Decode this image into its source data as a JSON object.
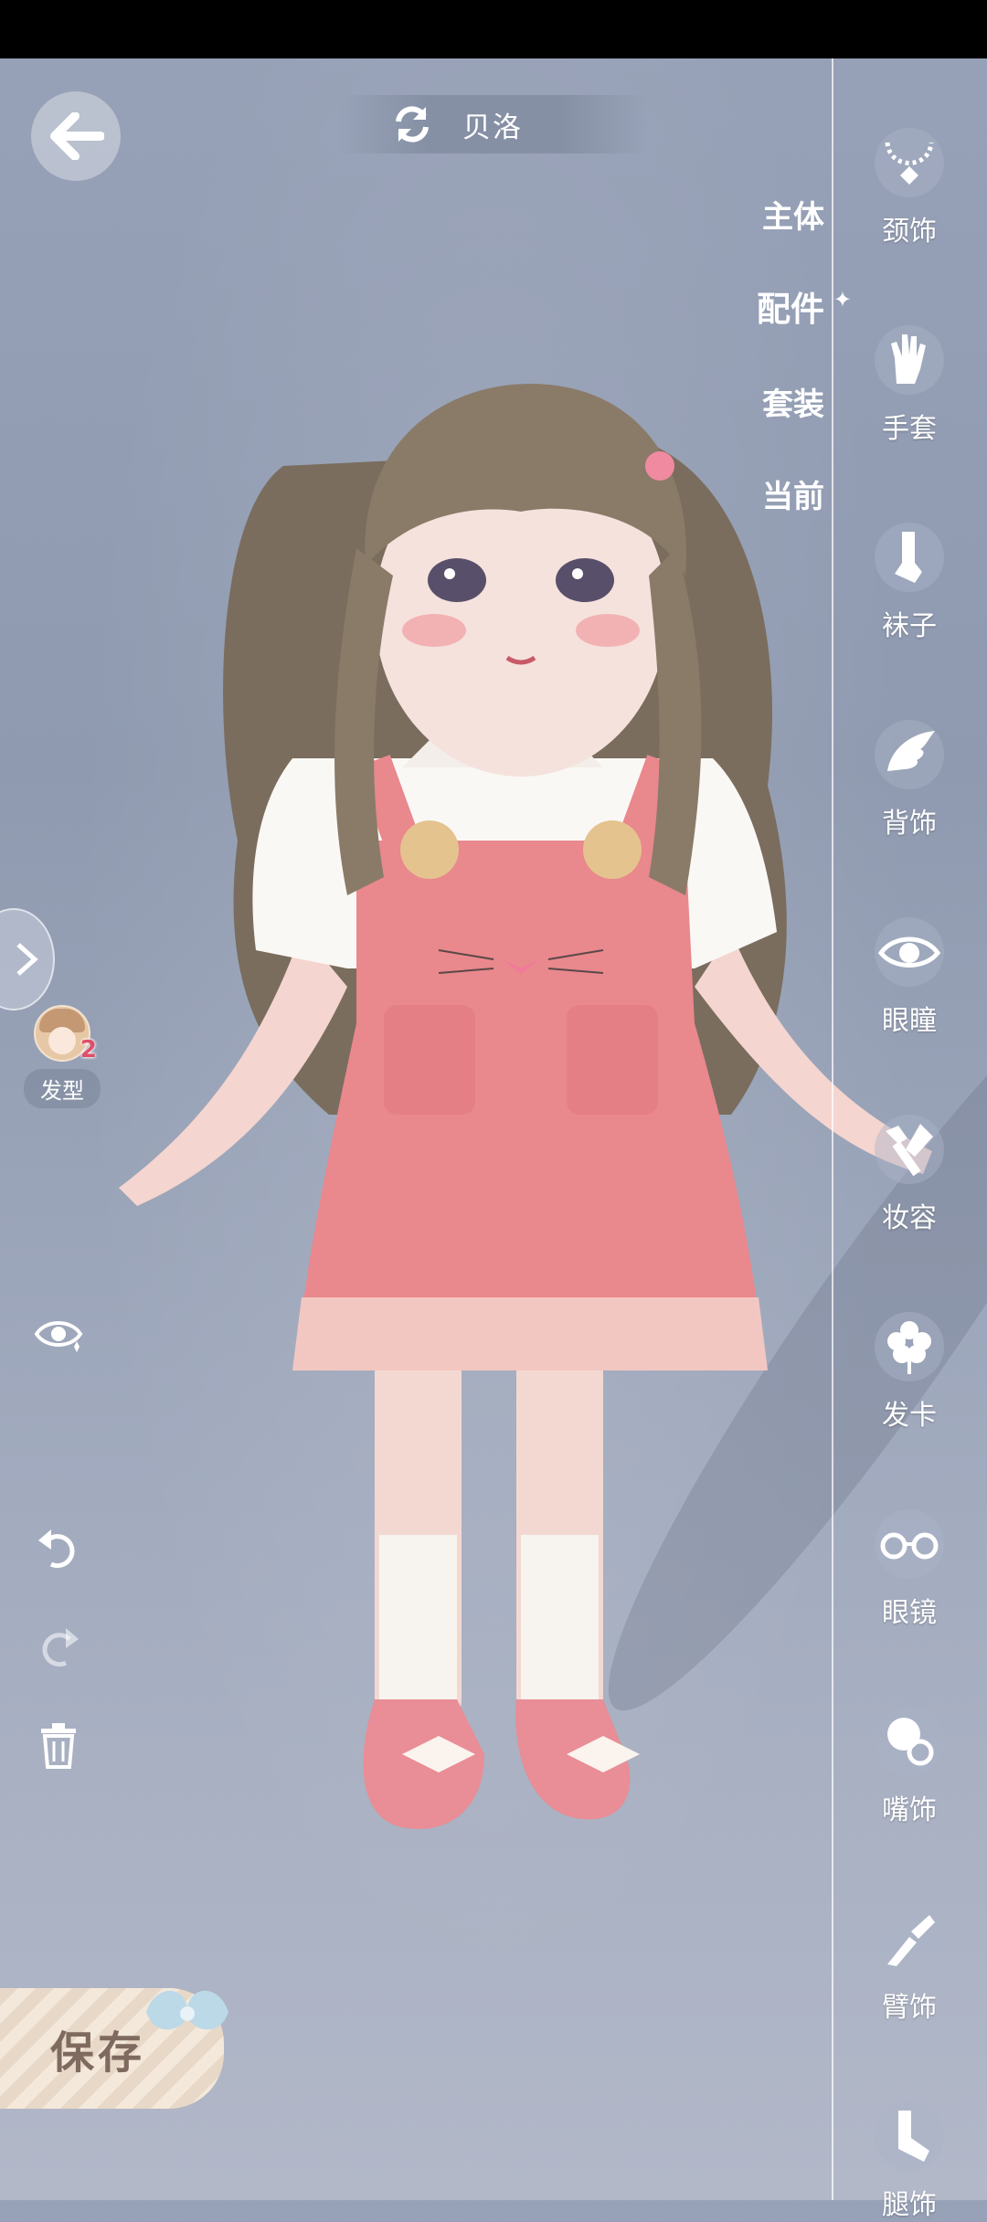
{
  "header": {
    "character_name": "贝洛"
  },
  "categories": [
    {
      "label": "主体",
      "active": false
    },
    {
      "label": "配件",
      "active": true
    },
    {
      "label": "套装",
      "active": false
    },
    {
      "label": "当前",
      "active": false
    }
  ],
  "slots": [
    {
      "label": "颈饰",
      "icon": "necklace-icon"
    },
    {
      "label": "手套",
      "icon": "glove-icon"
    },
    {
      "label": "袜子",
      "icon": "socks-icon"
    },
    {
      "label": "背饰",
      "icon": "wing-icon"
    },
    {
      "label": "眼瞳",
      "icon": "eye-icon"
    },
    {
      "label": "妆容",
      "icon": "makeup-brush-icon"
    },
    {
      "label": "发卡",
      "icon": "hairclip-flower-icon"
    },
    {
      "label": "眼镜",
      "icon": "glasses-icon"
    },
    {
      "label": "嘴饰",
      "icon": "pacifier-icon"
    },
    {
      "label": "臂饰",
      "icon": "arm-accessory-icon"
    },
    {
      "label": "腿饰",
      "icon": "leg-accessory-icon"
    }
  ],
  "left_panel": {
    "hair_label": "发型",
    "hair_count": "2"
  },
  "save_label": "保存",
  "colors": {
    "background": "#97a1b7",
    "dress_pink": "#e9888d",
    "save_text": "#7f6a5f"
  }
}
